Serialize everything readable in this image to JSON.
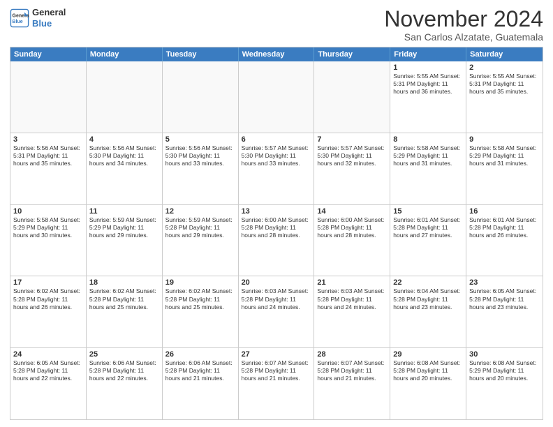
{
  "logo": {
    "line1": "General",
    "line2": "Blue"
  },
  "title": "November 2024",
  "location": "San Carlos Alzatate, Guatemala",
  "header_days": [
    "Sunday",
    "Monday",
    "Tuesday",
    "Wednesday",
    "Thursday",
    "Friday",
    "Saturday"
  ],
  "rows": [
    [
      {
        "day": "",
        "empty": true,
        "text": ""
      },
      {
        "day": "",
        "empty": true,
        "text": ""
      },
      {
        "day": "",
        "empty": true,
        "text": ""
      },
      {
        "day": "",
        "empty": true,
        "text": ""
      },
      {
        "day": "",
        "empty": true,
        "text": ""
      },
      {
        "day": "1",
        "text": "Sunrise: 5:55 AM\nSunset: 5:31 PM\nDaylight: 11 hours\nand 36 minutes."
      },
      {
        "day": "2",
        "text": "Sunrise: 5:55 AM\nSunset: 5:31 PM\nDaylight: 11 hours\nand 35 minutes."
      }
    ],
    [
      {
        "day": "3",
        "text": "Sunrise: 5:56 AM\nSunset: 5:31 PM\nDaylight: 11 hours\nand 35 minutes."
      },
      {
        "day": "4",
        "text": "Sunrise: 5:56 AM\nSunset: 5:30 PM\nDaylight: 11 hours\nand 34 minutes."
      },
      {
        "day": "5",
        "text": "Sunrise: 5:56 AM\nSunset: 5:30 PM\nDaylight: 11 hours\nand 33 minutes."
      },
      {
        "day": "6",
        "text": "Sunrise: 5:57 AM\nSunset: 5:30 PM\nDaylight: 11 hours\nand 33 minutes."
      },
      {
        "day": "7",
        "text": "Sunrise: 5:57 AM\nSunset: 5:30 PM\nDaylight: 11 hours\nand 32 minutes."
      },
      {
        "day": "8",
        "text": "Sunrise: 5:58 AM\nSunset: 5:29 PM\nDaylight: 11 hours\nand 31 minutes."
      },
      {
        "day": "9",
        "text": "Sunrise: 5:58 AM\nSunset: 5:29 PM\nDaylight: 11 hours\nand 31 minutes."
      }
    ],
    [
      {
        "day": "10",
        "text": "Sunrise: 5:58 AM\nSunset: 5:29 PM\nDaylight: 11 hours\nand 30 minutes."
      },
      {
        "day": "11",
        "text": "Sunrise: 5:59 AM\nSunset: 5:29 PM\nDaylight: 11 hours\nand 29 minutes."
      },
      {
        "day": "12",
        "text": "Sunrise: 5:59 AM\nSunset: 5:28 PM\nDaylight: 11 hours\nand 29 minutes."
      },
      {
        "day": "13",
        "text": "Sunrise: 6:00 AM\nSunset: 5:28 PM\nDaylight: 11 hours\nand 28 minutes."
      },
      {
        "day": "14",
        "text": "Sunrise: 6:00 AM\nSunset: 5:28 PM\nDaylight: 11 hours\nand 28 minutes."
      },
      {
        "day": "15",
        "text": "Sunrise: 6:01 AM\nSunset: 5:28 PM\nDaylight: 11 hours\nand 27 minutes."
      },
      {
        "day": "16",
        "text": "Sunrise: 6:01 AM\nSunset: 5:28 PM\nDaylight: 11 hours\nand 26 minutes."
      }
    ],
    [
      {
        "day": "17",
        "text": "Sunrise: 6:02 AM\nSunset: 5:28 PM\nDaylight: 11 hours\nand 26 minutes."
      },
      {
        "day": "18",
        "text": "Sunrise: 6:02 AM\nSunset: 5:28 PM\nDaylight: 11 hours\nand 25 minutes."
      },
      {
        "day": "19",
        "text": "Sunrise: 6:02 AM\nSunset: 5:28 PM\nDaylight: 11 hours\nand 25 minutes."
      },
      {
        "day": "20",
        "text": "Sunrise: 6:03 AM\nSunset: 5:28 PM\nDaylight: 11 hours\nand 24 minutes."
      },
      {
        "day": "21",
        "text": "Sunrise: 6:03 AM\nSunset: 5:28 PM\nDaylight: 11 hours\nand 24 minutes."
      },
      {
        "day": "22",
        "text": "Sunrise: 6:04 AM\nSunset: 5:28 PM\nDaylight: 11 hours\nand 23 minutes."
      },
      {
        "day": "23",
        "text": "Sunrise: 6:05 AM\nSunset: 5:28 PM\nDaylight: 11 hours\nand 23 minutes."
      }
    ],
    [
      {
        "day": "24",
        "text": "Sunrise: 6:05 AM\nSunset: 5:28 PM\nDaylight: 11 hours\nand 22 minutes."
      },
      {
        "day": "25",
        "text": "Sunrise: 6:06 AM\nSunset: 5:28 PM\nDaylight: 11 hours\nand 22 minutes."
      },
      {
        "day": "26",
        "text": "Sunrise: 6:06 AM\nSunset: 5:28 PM\nDaylight: 11 hours\nand 21 minutes."
      },
      {
        "day": "27",
        "text": "Sunrise: 6:07 AM\nSunset: 5:28 PM\nDaylight: 11 hours\nand 21 minutes."
      },
      {
        "day": "28",
        "text": "Sunrise: 6:07 AM\nSunset: 5:28 PM\nDaylight: 11 hours\nand 21 minutes."
      },
      {
        "day": "29",
        "text": "Sunrise: 6:08 AM\nSunset: 5:28 PM\nDaylight: 11 hours\nand 20 minutes."
      },
      {
        "day": "30",
        "text": "Sunrise: 6:08 AM\nSunset: 5:29 PM\nDaylight: 11 hours\nand 20 minutes."
      }
    ]
  ]
}
